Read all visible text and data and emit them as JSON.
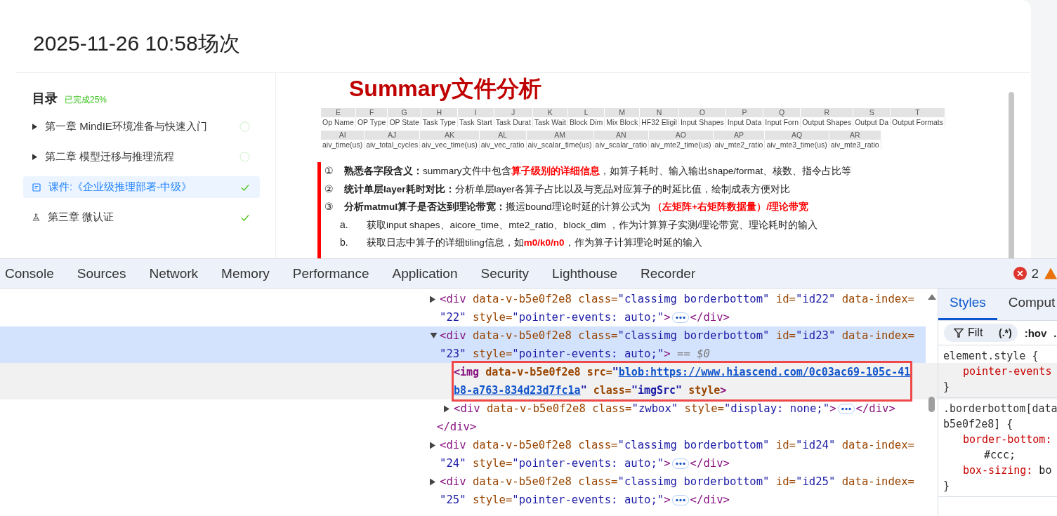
{
  "page": {
    "title": "2025-11-26 10:58场次"
  },
  "toc": {
    "heading": "目录",
    "progress": "已完成25%",
    "items": [
      {
        "kind": "chapter",
        "label": "第一章 MindIE环境准备与快速入门",
        "selected": false,
        "done": false
      },
      {
        "kind": "chapter",
        "label": "第二章 模型迁移与推理流程",
        "selected": false,
        "done": false
      },
      {
        "kind": "courseware",
        "label": "课件:《企业级推理部署-中级》",
        "selected": true,
        "done": true
      },
      {
        "kind": "exam",
        "label": "第三章 微认证",
        "selected": false,
        "done": true
      }
    ]
  },
  "slide": {
    "title": "Summary文件分析",
    "tables": [
      {
        "columns": [
          {
            "letter": "E",
            "header": "Op Name"
          },
          {
            "letter": "F",
            "header": "OP Type"
          },
          {
            "letter": "G",
            "header": "OP State"
          },
          {
            "letter": "H",
            "header": "Task Type"
          },
          {
            "letter": "I",
            "header": "Task Start"
          },
          {
            "letter": "J",
            "header": "Task Durat"
          },
          {
            "letter": "K",
            "header": "Task Wait"
          },
          {
            "letter": "L",
            "header": "Block Dim"
          },
          {
            "letter": "M",
            "header": "Mix Block"
          },
          {
            "letter": "N",
            "header": "HF32 Eligil"
          },
          {
            "letter": "O",
            "header": "Input Shapes"
          },
          {
            "letter": "P",
            "header": "Input Data"
          },
          {
            "letter": "Q",
            "header": "Input Forn"
          },
          {
            "letter": "R",
            "header": "Output Shapes"
          },
          {
            "letter": "S",
            "header": "Output Da"
          },
          {
            "letter": "T",
            "header": "Output Formats"
          }
        ]
      },
      {
        "columns": [
          {
            "letter": "AI",
            "header": "aiv_time(us)"
          },
          {
            "letter": "AJ",
            "header": "aiv_total_cycles"
          },
          {
            "letter": "AK",
            "header": "aiv_vec_time(us)"
          },
          {
            "letter": "AL",
            "header": "aiv_vec_ratio"
          },
          {
            "letter": "AM",
            "header": "aiv_scalar_time(us)"
          },
          {
            "letter": "AN",
            "header": "aiv_scalar_ratio"
          },
          {
            "letter": "AO",
            "header": "aiv_mte2_time(us)"
          },
          {
            "letter": "AP",
            "header": "aiv_mte2_ratio"
          },
          {
            "letter": "AQ",
            "header": "aiv_mte3_time(us)"
          },
          {
            "letter": "AR",
            "header": "aiv_mte3_ratio"
          }
        ]
      }
    ],
    "points": [
      {
        "kind": "numbered",
        "mark": "①",
        "parts": [
          {
            "kind": "bold",
            "text": "熟悉各字段含义："
          },
          {
            "kind": "plain",
            "text": "summary文件中包含"
          },
          {
            "kind": "emphasis",
            "text": "算子级别的详细信息"
          },
          {
            "kind": "plain",
            "text": "，如算子耗时、输入输出shape/format、核数、指令占比等"
          }
        ]
      },
      {
        "kind": "numbered",
        "mark": "②",
        "parts": [
          {
            "kind": "bold",
            "text": "统计单层layer耗时对比："
          },
          {
            "kind": "plain",
            "text": "分析单层layer各算子占比以及与竞品对应算子的时延比值，绘制成表方便对比"
          }
        ]
      },
      {
        "kind": "numbered",
        "mark": "③",
        "parts": [
          {
            "kind": "bold",
            "text": "分析matmul算子是否达到理论带宽："
          },
          {
            "kind": "plain",
            "text": "搬运bound理论时延的计算公式为 "
          },
          {
            "kind": "emphasis",
            "text": "（左矩阵+右矩阵数据量）/理论带宽"
          }
        ]
      },
      {
        "kind": "lettered",
        "mark": "a.",
        "parts": [
          {
            "kind": "plain",
            "text": "获取input shapes、aicore_time、mte2_ratio、block_dim ，作为计算算子实测/理论带宽、理论耗时的输入"
          }
        ]
      },
      {
        "kind": "lettered",
        "mark": "b.",
        "parts": [
          {
            "kind": "plain",
            "text": "获取日志中算子的详细tiling信息，如"
          },
          {
            "kind": "emphasis",
            "text": "m0/k0/n0"
          },
          {
            "kind": "plain",
            "text": "，作为算子计算理论时延的输入"
          }
        ]
      }
    ]
  },
  "devtools": {
    "tabs": [
      {
        "label": "Console",
        "selected": false
      },
      {
        "label": "Sources",
        "selected": false
      },
      {
        "label": "Network",
        "selected": false
      },
      {
        "label": "Memory",
        "selected": false
      },
      {
        "label": "Performance",
        "selected": false
      },
      {
        "label": "Application",
        "selected": false
      },
      {
        "label": "Security",
        "selected": false
      },
      {
        "label": "Lighthouse",
        "selected": false
      },
      {
        "label": "Recorder",
        "selected": false
      }
    ],
    "error_count": "2",
    "dom_nodes": [
      {
        "expanded": false,
        "selected": false,
        "hovered": false,
        "annotated": false,
        "lines": [
          [
            {
              "kind": "tag",
              "text": "<div"
            },
            {
              "kind": "attr",
              "text": " data-v-b5e0f2e8 class="
            },
            {
              "kind": "value",
              "text": "\"classimg borderbottom\""
            },
            {
              "kind": "attr",
              "text": " id="
            },
            {
              "kind": "value",
              "text": "\"id22\""
            },
            {
              "kind": "attr",
              "text": " data-index="
            }
          ],
          [
            {
              "kind": "value",
              "text": "\"22\""
            },
            {
              "kind": "attr",
              "text": " style="
            },
            {
              "kind": "value",
              "text": "\"pointer-events: auto;\""
            },
            {
              "kind": "tag",
              "text": ">"
            },
            {
              "kind": "ellipsis"
            },
            {
              "kind": "tag",
              "text": "</div>"
            }
          ]
        ]
      },
      {
        "expanded": true,
        "selected": true,
        "hovered": false,
        "annotated": false,
        "lines": [
          [
            {
              "kind": "tag",
              "text": "<div"
            },
            {
              "kind": "attr",
              "text": " data-v-b5e0f2e8 class="
            },
            {
              "kind": "value",
              "text": "\"classimg borderbottom\""
            },
            {
              "kind": "attr",
              "text": " id="
            },
            {
              "kind": "value",
              "text": "\"id23\""
            },
            {
              "kind": "attr",
              "text": " data-index="
            }
          ],
          [
            {
              "kind": "value",
              "text": "\"23\""
            },
            {
              "kind": "attr",
              "text": " style="
            },
            {
              "kind": "value",
              "text": "\"pointer-events: auto;\""
            },
            {
              "kind": "tag",
              "text": ">"
            },
            {
              "kind": "marker",
              "text": " == $0"
            }
          ]
        ],
        "children": [
          {
            "selected": false,
            "hovered": true,
            "annotated": true,
            "lines": [
              [
                {
                  "kind": "tag",
                  "text": "<img"
                },
                {
                  "kind": "attr",
                  "text": " data-v-b5e0f2e8 src="
                },
                {
                  "kind": "value",
                  "text": "\""
                },
                {
                  "kind": "link",
                  "text": "blob:https://www.hiascend.com/0c03ac69-105c-41"
                }
              ],
              [
                {
                  "kind": "link",
                  "text": "b8-a763-834d23d7fc1a"
                },
                {
                  "kind": "value",
                  "text": "\""
                },
                {
                  "kind": "attr",
                  "text": " class="
                },
                {
                  "kind": "value",
                  "text": "\"imgSrc\""
                },
                {
                  "kind": "attr",
                  "text": " style"
                },
                {
                  "kind": "tag",
                  "text": ">"
                }
              ]
            ]
          },
          {
            "expanded": false,
            "selected": false,
            "hovered": false,
            "annotated": false,
            "lines": [
              [
                {
                  "kind": "tag",
                  "text": "<div"
                },
                {
                  "kind": "attr",
                  "text": " data-v-b5e0f2e8 class="
                },
                {
                  "kind": "value",
                  "text": "\"zwbox\""
                },
                {
                  "kind": "attr",
                  "text": " style="
                },
                {
                  "kind": "value",
                  "text": "\"display: none;\""
                },
                {
                  "kind": "tag",
                  "text": ">"
                },
                {
                  "kind": "ellipsis"
                },
                {
                  "kind": "tag",
                  "text": "</div>"
                }
              ]
            ]
          }
        ],
        "closing": [
          {
            "kind": "tag",
            "text": "</div>"
          }
        ]
      },
      {
        "expanded": false,
        "selected": false,
        "hovered": false,
        "annotated": false,
        "lines": [
          [
            {
              "kind": "tag",
              "text": "<div"
            },
            {
              "kind": "attr",
              "text": " data-v-b5e0f2e8 class="
            },
            {
              "kind": "value",
              "text": "\"classimg borderbottom\""
            },
            {
              "kind": "attr",
              "text": " id="
            },
            {
              "kind": "value",
              "text": "\"id24\""
            },
            {
              "kind": "attr",
              "text": " data-index="
            }
          ],
          [
            {
              "kind": "value",
              "text": "\"24\""
            },
            {
              "kind": "attr",
              "text": " style="
            },
            {
              "kind": "value",
              "text": "\"pointer-events: auto;\""
            },
            {
              "kind": "tag",
              "text": ">"
            },
            {
              "kind": "ellipsis"
            },
            {
              "kind": "tag",
              "text": "</div>"
            }
          ]
        ]
      },
      {
        "expanded": false,
        "selected": false,
        "hovered": false,
        "annotated": false,
        "lines": [
          [
            {
              "kind": "tag",
              "text": "<div"
            },
            {
              "kind": "attr",
              "text": " data-v-b5e0f2e8 class="
            },
            {
              "kind": "value",
              "text": "\"classimg borderbottom\""
            },
            {
              "kind": "attr",
              "text": " id="
            },
            {
              "kind": "value",
              "text": "\"id25\""
            },
            {
              "kind": "attr",
              "text": " data-index="
            }
          ],
          [
            {
              "kind": "value",
              "text": "\"25\""
            },
            {
              "kind": "attr",
              "text": " style="
            },
            {
              "kind": "value",
              "text": "\"pointer-events: auto;\""
            },
            {
              "kind": "tag",
              "text": ">"
            },
            {
              "kind": "ellipsis"
            },
            {
              "kind": "tag",
              "text": "</div>"
            }
          ]
        ]
      }
    ],
    "side_tabs": [
      {
        "label": "Styles",
        "selected": true
      },
      {
        "label": "Comput",
        "selected": false
      }
    ],
    "filter": {
      "placeholder": "Filt",
      "regex": "(.*)",
      "hov": ":hov",
      "more": "."
    },
    "rules": [
      {
        "lines": [
          [
            {
              "kind": "selector",
              "text": "element.style {"
            }
          ],
          [
            {
              "kind": "indent"
            },
            {
              "kind": "prop",
              "text": "pointer-events"
            }
          ],
          [
            {
              "kind": "brace",
              "text": "}"
            }
          ]
        ]
      },
      {
        "lines": [
          [
            {
              "kind": "selector",
              "text": ".borderbottom[data"
            }
          ],
          [
            {
              "kind": "selector",
              "text": "b5e0f2e8] {"
            }
          ],
          [
            {
              "kind": "indent"
            },
            {
              "kind": "prop",
              "text": "border-bottom:"
            }
          ],
          [
            {
              "kind": "indent2"
            },
            {
              "kind": "val",
              "text": "#ccc;"
            }
          ],
          [
            {
              "kind": "indent"
            },
            {
              "kind": "prop",
              "text": "box-sizing:"
            },
            {
              "kind": "val",
              "text": " bo"
            }
          ],
          [
            {
              "kind": "brace",
              "text": "}"
            }
          ]
        ]
      }
    ]
  }
}
